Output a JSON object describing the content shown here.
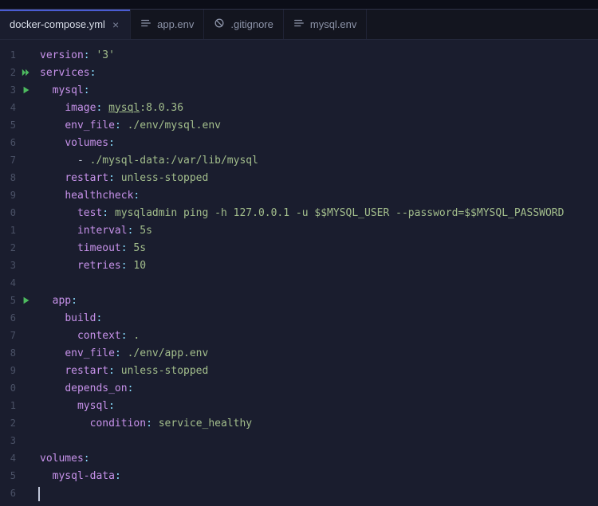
{
  "tabs": [
    {
      "label": "docker-compose.yml",
      "active": true,
      "icon": "none"
    },
    {
      "label": "app.env",
      "active": false,
      "icon": "lines"
    },
    {
      "label": ".gitignore",
      "active": false,
      "icon": "block"
    },
    {
      "label": "mysql.env",
      "active": false,
      "icon": "lines"
    }
  ],
  "gutter": {
    "icons": {
      "2": "play-double",
      "3": "play",
      "15": "play"
    }
  },
  "code": {
    "lines": [
      [
        [
          "k",
          "version"
        ],
        [
          "p",
          ":"
        ],
        [
          "c",
          " "
        ],
        [
          "s",
          "'3'"
        ]
      ],
      [
        [
          "k",
          "services"
        ],
        [
          "p",
          ":"
        ]
      ],
      [
        [
          "c",
          "  "
        ],
        [
          "k",
          "mysql"
        ],
        [
          "p",
          ":"
        ]
      ],
      [
        [
          "c",
          "    "
        ],
        [
          "k",
          "image"
        ],
        [
          "p",
          ":"
        ],
        [
          "c",
          " "
        ],
        [
          "su",
          "mysql"
        ],
        [
          "s",
          ":8.0.36"
        ]
      ],
      [
        [
          "c",
          "    "
        ],
        [
          "k",
          "env_file"
        ],
        [
          "p",
          ":"
        ],
        [
          "c",
          " "
        ],
        [
          "s",
          "./env/mysql.env"
        ]
      ],
      [
        [
          "c",
          "    "
        ],
        [
          "k",
          "volumes"
        ],
        [
          "p",
          ":"
        ]
      ],
      [
        [
          "c",
          "      - "
        ],
        [
          "s",
          "./mysql-data:/var/lib/mysql"
        ]
      ],
      [
        [
          "c",
          "    "
        ],
        [
          "k",
          "restart"
        ],
        [
          "p",
          ":"
        ],
        [
          "c",
          " "
        ],
        [
          "s",
          "unless-stopped"
        ]
      ],
      [
        [
          "c",
          "    "
        ],
        [
          "k",
          "healthcheck"
        ],
        [
          "p",
          ":"
        ]
      ],
      [
        [
          "c",
          "      "
        ],
        [
          "k",
          "test"
        ],
        [
          "p",
          ":"
        ],
        [
          "c",
          " "
        ],
        [
          "s",
          "mysqladmin ping -h 127.0.0.1 -u $$MYSQL_USER --password=$$MYSQL_PASSWORD"
        ]
      ],
      [
        [
          "c",
          "      "
        ],
        [
          "k",
          "interval"
        ],
        [
          "p",
          ":"
        ],
        [
          "c",
          " "
        ],
        [
          "s",
          "5s"
        ]
      ],
      [
        [
          "c",
          "      "
        ],
        [
          "k",
          "timeout"
        ],
        [
          "p",
          ":"
        ],
        [
          "c",
          " "
        ],
        [
          "s",
          "5s"
        ]
      ],
      [
        [
          "c",
          "      "
        ],
        [
          "k",
          "retries"
        ],
        [
          "p",
          ":"
        ],
        [
          "c",
          " "
        ],
        [
          "s",
          "10"
        ]
      ],
      [],
      [
        [
          "c",
          "  "
        ],
        [
          "k",
          "app"
        ],
        [
          "p",
          ":"
        ]
      ],
      [
        [
          "c",
          "    "
        ],
        [
          "k",
          "build"
        ],
        [
          "p",
          ":"
        ]
      ],
      [
        [
          "c",
          "      "
        ],
        [
          "k",
          "context"
        ],
        [
          "p",
          ":"
        ],
        [
          "c",
          " "
        ],
        [
          "s",
          "."
        ]
      ],
      [
        [
          "c",
          "    "
        ],
        [
          "k",
          "env_file"
        ],
        [
          "p",
          ":"
        ],
        [
          "c",
          " "
        ],
        [
          "s",
          "./env/app.env"
        ]
      ],
      [
        [
          "c",
          "    "
        ],
        [
          "k",
          "restart"
        ],
        [
          "p",
          ":"
        ],
        [
          "c",
          " "
        ],
        [
          "s",
          "unless-stopped"
        ]
      ],
      [
        [
          "c",
          "    "
        ],
        [
          "k",
          "depends_on"
        ],
        [
          "p",
          ":"
        ]
      ],
      [
        [
          "c",
          "      "
        ],
        [
          "k",
          "mysql"
        ],
        [
          "p",
          ":"
        ]
      ],
      [
        [
          "c",
          "        "
        ],
        [
          "k",
          "condition"
        ],
        [
          "p",
          ":"
        ],
        [
          "c",
          " "
        ],
        [
          "s",
          "service_healthy"
        ]
      ],
      [],
      [
        [
          "k",
          "volumes"
        ],
        [
          "p",
          ":"
        ]
      ],
      [
        [
          "c",
          "  "
        ],
        [
          "k",
          "mysql-data"
        ],
        [
          "p",
          ":"
        ]
      ],
      []
    ]
  }
}
